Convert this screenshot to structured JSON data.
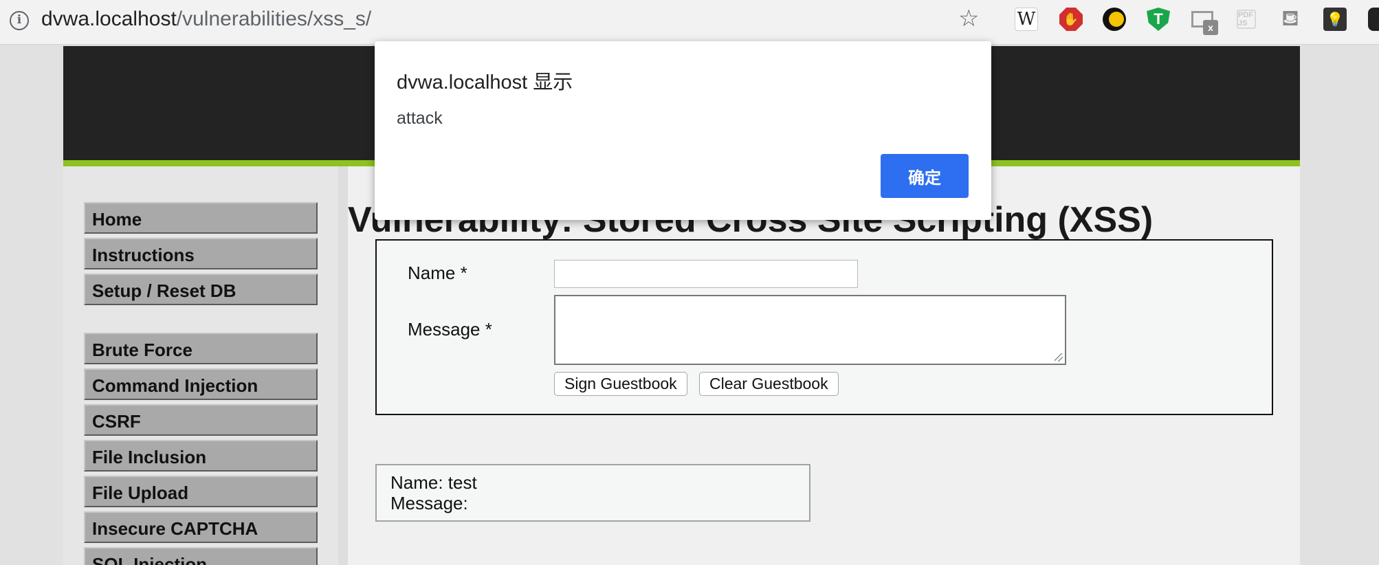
{
  "browser": {
    "url_host": "dvwa.localhost",
    "url_path": "/vulnerabilities/xss_s/",
    "extensions": [
      "star-icon",
      "wikipedia-icon",
      "adblock-icon",
      "dark-mode-icon",
      "t-shield-icon",
      "mail-icon",
      "pdf-icon",
      "paint-bucket-icon",
      "bulb-icon"
    ],
    "ext_labels": {
      "w": "W",
      "adblock": "✋",
      "t": "T",
      "mail_x": "x",
      "pdf": "PDF JS",
      "bulb": "💡"
    }
  },
  "sidebar": {
    "items": [
      {
        "label": "Home"
      },
      {
        "label": "Instructions"
      },
      {
        "label": "Setup / Reset DB"
      },
      {
        "label": "Brute Force"
      },
      {
        "label": "Command Injection"
      },
      {
        "label": "CSRF"
      },
      {
        "label": "File Inclusion"
      },
      {
        "label": "File Upload"
      },
      {
        "label": "Insecure CAPTCHA"
      },
      {
        "label": "SQL Injection"
      }
    ]
  },
  "main": {
    "title": "Vulnerability: Stored Cross Site Scripting (XSS)",
    "form": {
      "name_label": "Name *",
      "name_value": "",
      "message_label": "Message *",
      "message_value": "",
      "sign_button": "Sign Guestbook",
      "clear_button": "Clear Guestbook"
    },
    "entry": {
      "name_line": "Name: test",
      "message_line": "Message:"
    }
  },
  "dialog": {
    "title": "dvwa.localhost 显示",
    "message": "attack",
    "ok_label": "确定"
  },
  "colors": {
    "header": "#232323",
    "accent_green": "#8dc21f",
    "menu_button": "#a9a9a9",
    "dialog_button": "#2d6ff0"
  }
}
